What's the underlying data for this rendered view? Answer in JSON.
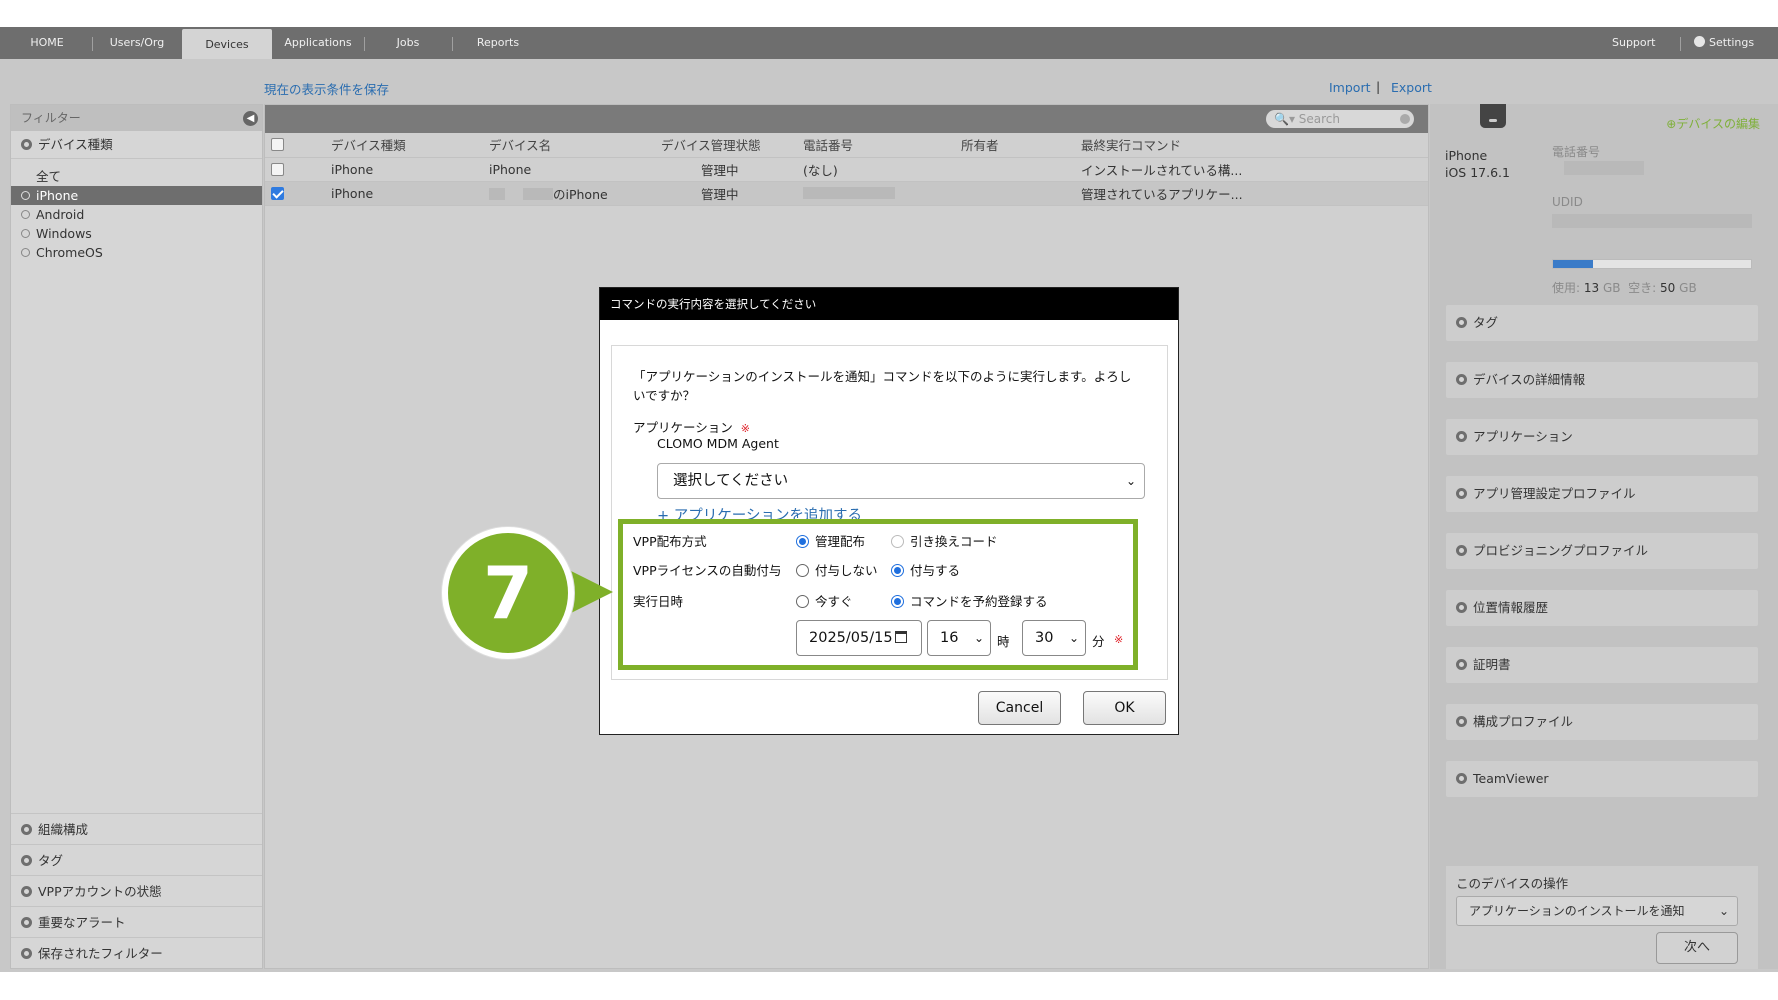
{
  "nav": {
    "tabs": [
      "HOME",
      "Users/Org",
      "Devices",
      "Applications",
      "Jobs",
      "Reports"
    ],
    "active_tab": "Devices",
    "support": "Support",
    "settings": "Settings"
  },
  "toolbar": {
    "save_filter": "現在の表示条件を保存",
    "import": "Import",
    "divider": "|",
    "export": "Export"
  },
  "left_panel": {
    "filter_title": "フィルター",
    "device_type_header": "デバイス種類",
    "device_types": [
      "全て",
      "iPhone",
      "Android",
      "Windows",
      "ChromeOS"
    ],
    "selected_type": "iPhone",
    "bottom_sections": [
      "組織構成",
      "タグ",
      "VPPアカウントの状態",
      "重要なアラート",
      "保存されたフィルター"
    ]
  },
  "device_table": {
    "search_placeholder": "Search",
    "columns": [
      "デバイス種類",
      "デバイス名",
      "デバイス管理状態",
      "電話番号",
      "所有者",
      "最終実行コマンド"
    ],
    "rows": [
      {
        "type": "iPhone",
        "name": "iPhone",
        "status": "管理中",
        "phone": "(なし)",
        "owner": "",
        "last_command": "インストールされている構...",
        "checked": false
      },
      {
        "type": "iPhone",
        "name": "のiPhone",
        "status": "管理中",
        "phone": "",
        "owner": "",
        "last_command": "管理されているアプリケー...",
        "checked": true
      }
    ]
  },
  "right_panel": {
    "edit_link": "デバイスの編集",
    "device_model": "iPhone",
    "os_version": "iOS 17.6.1",
    "phone_label": "電話番号",
    "udid_label": "UDID",
    "storage": {
      "used_label": "使用:",
      "used_value": "13",
      "free_label": "空き:",
      "free_value": "50",
      "unit": "GB",
      "used_fraction": 0.2
    },
    "sections": [
      "タグ",
      "デバイスの詳細情報",
      "アプリケーション",
      "アプリ管理設定プロファイル",
      "プロビジョニングプロファイル",
      "位置情報履歴",
      "証明書",
      "構成プロファイル",
      "TeamViewer"
    ],
    "ops_title": "このデバイスの操作",
    "ops_selected": "アプリケーションのインストールを通知",
    "next_button": "次へ"
  },
  "dialog": {
    "title": "コマンドの実行内容を選択してください",
    "message_line1": "「アプリケーションのインストールを通知」コマンドを以下のように実行します。よろし",
    "message_line2": "いですか？",
    "app_label": "アプリケーション",
    "required_mark": "※",
    "app_name": "CLOMO MDM Agent",
    "app_select_placeholder": "選択してください",
    "add_app_link": "+ アプリケーションを追加する",
    "vpp_method_label": "VPP配布方式",
    "vpp_method_options": [
      "管理配布",
      "引き換えコード"
    ],
    "vpp_method_selected": "管理配布",
    "vpp_license_label": "VPPライセンスの自動付与",
    "vpp_license_options": [
      "付与しない",
      "付与する"
    ],
    "vpp_license_selected": "付与する",
    "exec_time_label": "実行日時",
    "exec_time_options": [
      "今すぐ",
      "コマンドを予約登録する"
    ],
    "exec_time_selected": "コマンドを予約登録する",
    "date_value": "2025/05/15",
    "hour_value": "16",
    "hour_unit": "時",
    "minute_value": "30",
    "minute_unit": "分",
    "cancel": "Cancel",
    "ok": "OK"
  },
  "callout": {
    "number": "7",
    "color": "#7fb029"
  }
}
